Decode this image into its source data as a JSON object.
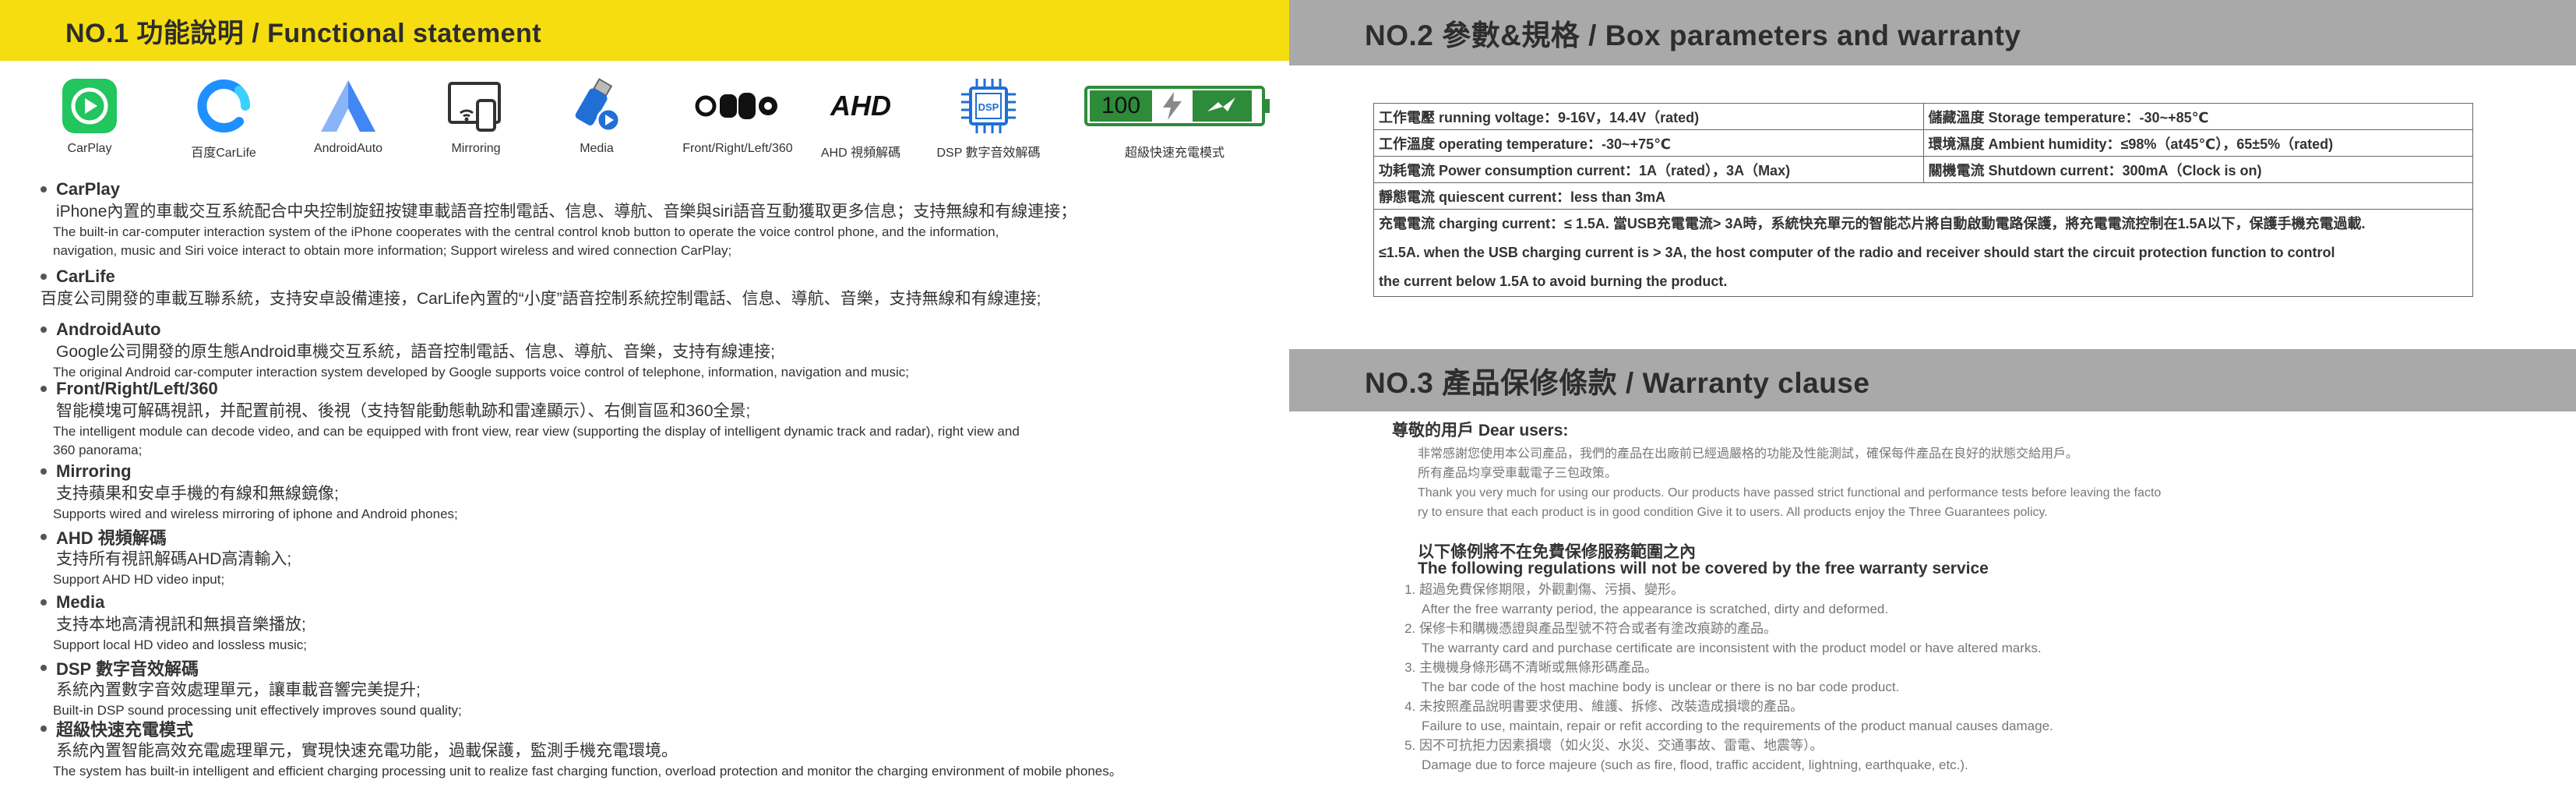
{
  "section1": {
    "title": "NO.1 功能說明 / Functional statement"
  },
  "section2": {
    "title": "NO.2 參數&規格 / Box parameters and warranty"
  },
  "section3": {
    "title": "NO.3 產品保修條款 / Warranty clause"
  },
  "icons": [
    {
      "label": "CarPlay",
      "icon": "carplay-icon",
      "color": "#22c55e"
    },
    {
      "label": "百度CarLife",
      "icon": "carlife-icon",
      "color": "#1e90ff"
    },
    {
      "label": "AndroidAuto",
      "icon": "android-auto-icon",
      "color": "#4285f4"
    },
    {
      "label": "Mirroring",
      "icon": "mirroring-icon"
    },
    {
      "label": "Media",
      "icon": "usb-media-icon",
      "color": "#1f6fd6"
    },
    {
      "label": "Front/Right/Left/360",
      "icon": "cameras-icon"
    },
    {
      "label": "AHD 視頻解碼",
      "icon": "ahd-icon",
      "text": "AHD"
    },
    {
      "label": "DSP 數字音效解碼",
      "icon": "dsp-chip-icon",
      "text": "DSP",
      "color": "#1e6fd6"
    },
    {
      "label": "超級快速充電模式",
      "icon": "fast-charge-battery-icon",
      "text": "100",
      "color": "#2e8b3a"
    }
  ],
  "features": [
    {
      "title": "CarPlay",
      "zh": "iPhone內置的車載交互系統配合中央控制旋鈕按键車載語音控制電話、信息、導航、音樂與siri語音互動獲取更多信息；支持無線和有線連接；",
      "en": [
        "The built-in car-computer interaction system of the iPhone cooperates with the central control knob button to operate the voice control phone, and the information,",
        "navigation, music and Siri voice interact to obtain more information; Support wireless and wired connection CarPlay;"
      ]
    },
    {
      "title": "CarLife",
      "zh": "百度公司開發的車載互聯系統，支持安卓設備連接，CarLife內置的“小度”語音控制系統控制電話、信息、導航、音樂，支持無線和有線連接;",
      "en": []
    },
    {
      "title": "AndroidAuto",
      "zh": "Google公司開發的原生態Android車機交互系統，語音控制電話、信息、導航、音樂，支持有線連接;",
      "en": [
        "The original Android car-computer interaction system developed by Google supports voice control of telephone, information, navigation and music;"
      ]
    },
    {
      "title": "Front/Right/Left/360",
      "zh": "智能模塊可解碼視訊，并配置前視、後視（支持智能動態軌跡和雷達顯示）、右側盲區和360全景;",
      "en": [
        "The intelligent module can decode video, and can be equipped with front view, rear view (supporting the display of intelligent dynamic track and radar), right view and",
        "360 panorama;"
      ]
    },
    {
      "title": "Mirroring",
      "zh": "支持蘋果和安卓手機的有線和無線鏡像;",
      "en": [
        "Supports wired and wireless mirroring of iphone and Android phones;"
      ]
    },
    {
      "title": "AHD 視頻解碼",
      "zh": "支持所有視訊解碼AHD高清輸入;",
      "en": [
        "Support AHD HD video input;"
      ]
    },
    {
      "title": "Media",
      "zh": "支持本地高清視訊和無損音樂播放;",
      "en": [
        "Support local HD video and lossless music;"
      ]
    },
    {
      "title": "DSP 數字音效解碼",
      "zh": "系統內置數字音效處理單元，讓車載音響完美提升;",
      "en": [
        "Built-in DSP sound processing unit effectively improves sound quality;"
      ]
    },
    {
      "title": "超級快速充電模式",
      "zh": "系統內置智能高效充電處理單元，實現快速充電功能，過載保護，監測手機充電環境。",
      "en": [
        "The system has built-in intelligent and efficient charging processing unit to realize fast charging function, overload protection and monitor the  charging environment of mobile phones。"
      ]
    }
  ],
  "params": {
    "r1c1": "工作電壓  running voltage：9-16V，14.4V（rated)",
    "r1c2": "儲藏溫度 Storage temperature：-30~+85℃",
    "r2c1": "工作溫度 operating temperature：-30~+75℃",
    "r2c2": "環境濕度 Ambient humidity：≤98%（at45℃），65±5%（rated)",
    "r3c1": "功耗電流 Power consumption current：1A（rated），3A（Max)",
    "r3c2": "關機電流 Shutdown current：300mA（Clock is on)",
    "r4": "靜態電流 quiescent current：less  than 3mA",
    "r5": [
      "充電電流 charging current：≤ 1.5A. 當USB充電電流> 3A時，系統快充單元的智能芯片將自動啟動電路保護，將充電電流控制在1.5A以下，保護手機充電過載.",
      "≤1.5A. when the USB charging current is > 3A, the host computer of the radio and receiver should start the circuit protection function to control",
      "the current below 1.5A to avoid burning the product."
    ]
  },
  "warranty": {
    "greeting": "尊敬的用戶 Dear users:",
    "intro": [
      "非常感謝您使用本公司產品，我們的產品在出廠前已經過嚴格的功能及性能測試，確保每件產品在良好的狀態交給用戶。",
      "所有產品均享受車載電子三包政策。",
      "Thank you very much for using our products. Our products have passed strict functional and performance tests before leaving the facto",
      "ry to ensure that each product is in good condition Give it to users. All products enjoy the Three Guarantees policy."
    ],
    "exclusions_zh": "以下條例將不在免費保修服務範圍之內",
    "exclusions_en": "The following regulations will not be covered by the free warranty service",
    "rules": [
      {
        "zh": "超過免費保修期限，外觀劃傷、污損、變形。",
        "en": "After the free warranty period, the appearance is scratched, dirty and deformed."
      },
      {
        "zh": "保修卡和購機憑證與產品型號不符合或者有塗改痕跡的產品。",
        "en": "The warranty card and purchase certificate are inconsistent with the product model or have altered marks."
      },
      {
        "zh": "主機機身條形碼不清晰或無條形碼產品。",
        "en": "The bar code of the host machine body is unclear or there is no bar code product."
      },
      {
        "zh": "未按照產品說明書要求使用、維護、拆修、改裝造成損壞的產品。",
        "en": "Failure to use, maintain, repair or refit according to the requirements of the product manual causes damage."
      },
      {
        "zh": "因不可抗拒力因素損壞（如火災、水災、交通事故、雷電、地震等）。",
        "en": "Damage due to force majeure (such as fire, flood, traffic accident, lightning, earthquake, etc.)."
      }
    ]
  }
}
